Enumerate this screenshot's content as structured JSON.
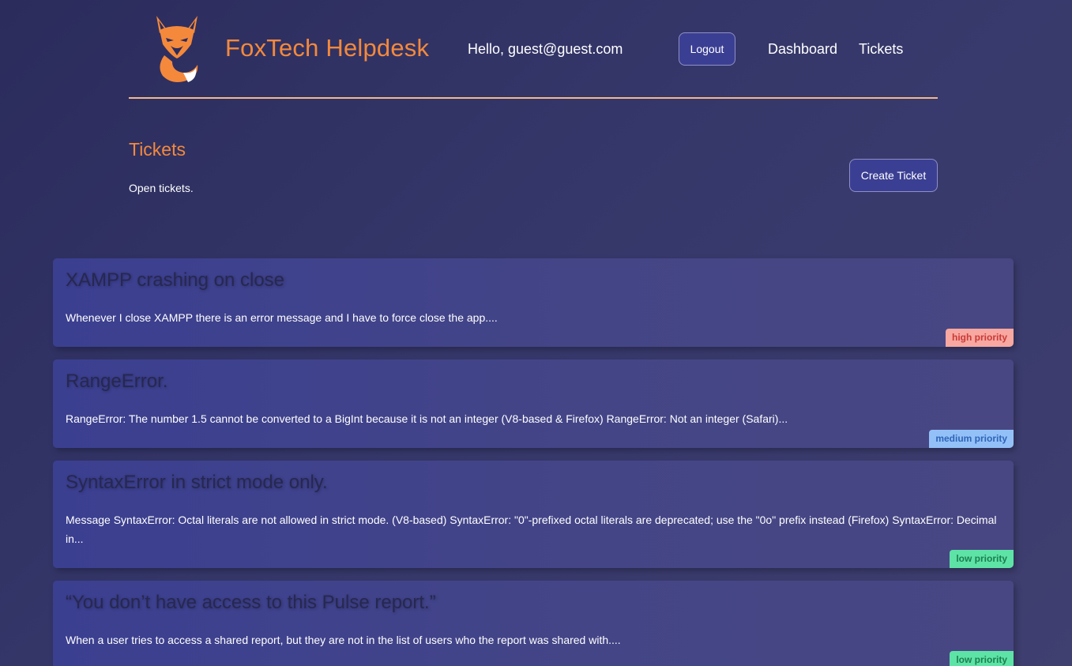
{
  "header": {
    "brand": "FoxTech Helpdesk",
    "greeting": "Hello, guest@guest.com",
    "logout_label": "Logout",
    "nav": {
      "dashboard": "Dashboard",
      "tickets": "Tickets"
    },
    "logo_icon": "fox-logo-icon"
  },
  "page": {
    "title": "Tickets",
    "subtitle": "Open tickets.",
    "create_label": "Create Ticket"
  },
  "tickets": [
    {
      "title": "XAMPP crashing on close",
      "description": "Whenever I close XAMPP there is an error message and I have to force close the app....",
      "priority": "high priority"
    },
    {
      "title": "RangeError.",
      "description": "RangeError: The number 1.5 cannot be converted to a BigInt because it is not an integer (V8-based & Firefox) RangeError: Not an integer (Safari)...",
      "priority": "medium priority"
    },
    {
      "title": "SyntaxError in strict mode only.",
      "description": "Message SyntaxError: Octal literals are not allowed in strict mode. (V8-based) SyntaxError: \"0\"-prefixed octal literals are deprecated; use the \"0o\" prefix instead (Firefox) SyntaxError: Decimal in...",
      "priority": "low priority"
    },
    {
      "title": "“You don’t have access to this Pulse report.”",
      "description": "When a user tries to access a shared report, but they are not in the list of users who the report was shared with....",
      "priority": "low priority"
    }
  ],
  "colors": {
    "accent": "#f4893c",
    "button_bg": "#3b3f93",
    "high": "#f8a7a1",
    "medium": "#93c1f7",
    "low": "#5ee3a6"
  }
}
